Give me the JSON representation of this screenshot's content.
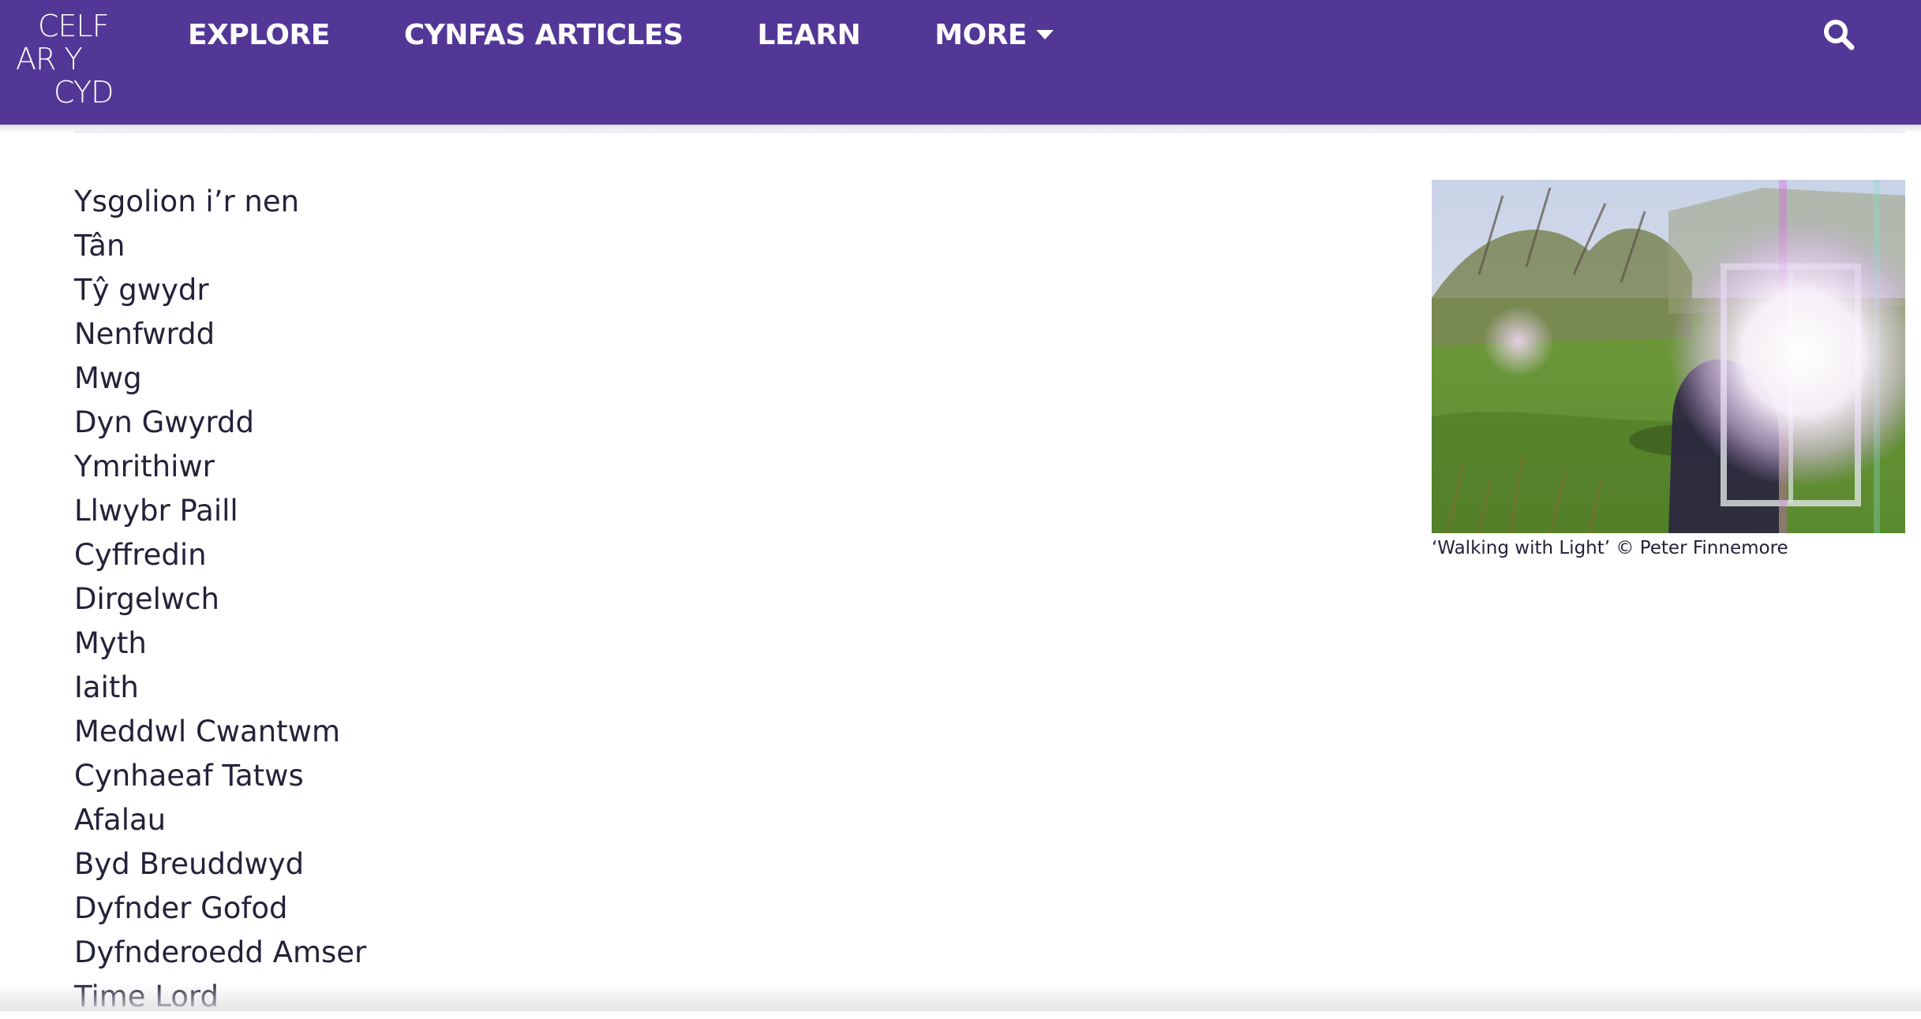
{
  "header": {
    "logo_lines": [
      "CELF",
      "AR Y",
      "CYD"
    ],
    "nav": [
      {
        "label": "EXPLORE"
      },
      {
        "label": "CYNFAS ARTICLES"
      },
      {
        "label": "LEARN"
      },
      {
        "label": "MORE",
        "has_dropdown": true
      }
    ],
    "search_icon": "search-icon",
    "colors": {
      "background": "#523797",
      "text": "#ffffff"
    }
  },
  "main": {
    "words": [
      "Ysgolion i’r nen",
      "Tân",
      "Tŷ gwydr",
      "Nenfwrdd",
      "Mwg",
      "Dyn Gwyrdd",
      "Ymrithiwr",
      "Llwybr Paill",
      "Cyffredin",
      "Dirgelwch",
      "Myth",
      "Iaith",
      "Meddwl Cwantwm",
      "Cynhaeaf Tatws",
      "Afalau",
      "Byd Breuddwyd",
      "Dyfnder Gofod",
      "Dyfnderoedd Amser",
      "Time Lord"
    ]
  },
  "figure": {
    "caption": "‘Walking with Light’ © Peter Finnemore"
  }
}
